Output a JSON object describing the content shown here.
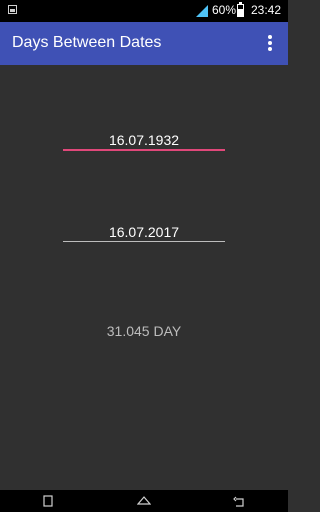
{
  "status_bar": {
    "battery_percent": "60%",
    "time": "23:42",
    "icons": [
      "notification-icon",
      "signal-icon",
      "battery-icon"
    ]
  },
  "app_bar": {
    "title": "Days Between Dates",
    "menu_icon": "overflow-menu-icon"
  },
  "form": {
    "start_date": "16.07.1932",
    "end_date": "16.07.2017",
    "focus_color": "#e0487a"
  },
  "result": {
    "text": "31.045 DAY"
  },
  "nav_bar": {
    "icons": [
      "recent-apps-icon",
      "home-icon",
      "back-icon"
    ]
  },
  "colors": {
    "primary": "#3f51b5",
    "background": "#303030"
  }
}
